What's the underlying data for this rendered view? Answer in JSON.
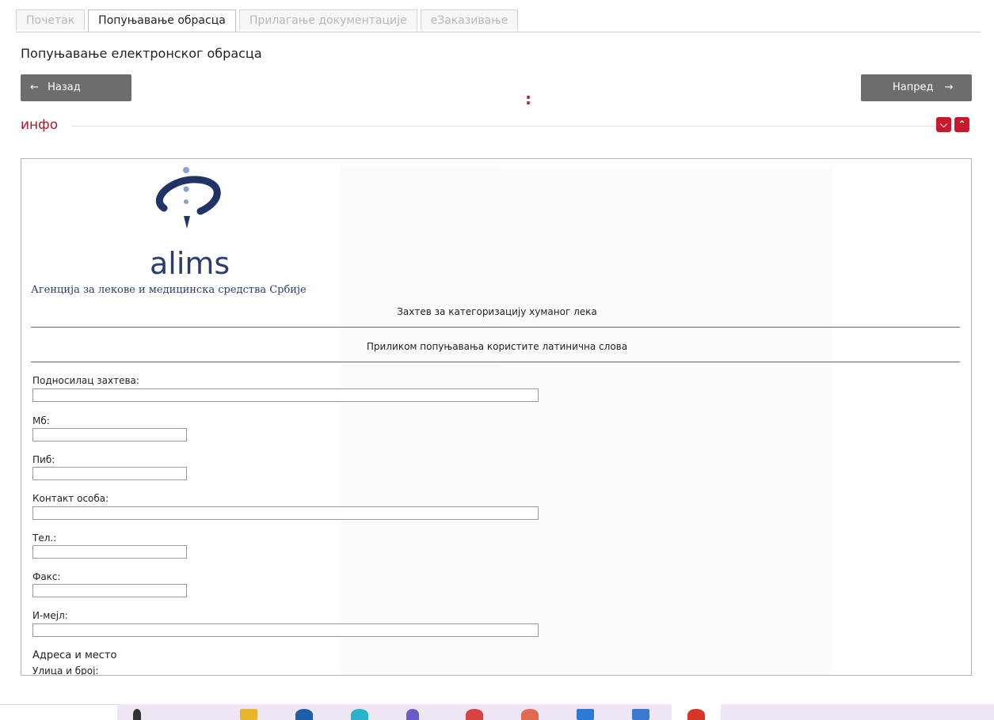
{
  "tabs": [
    {
      "label": "Почетак",
      "active": false
    },
    {
      "label": "Попуњавање обрасца",
      "active": true
    },
    {
      "label": "Прилагање документације",
      "active": false
    },
    {
      "label": "еЗаказивање",
      "active": false
    }
  ],
  "page_heading": "Попуњавање електронског обрасца",
  "nav": {
    "back_label": "Назад",
    "next_label": "Напред",
    "back_icon": "arrow-left-icon",
    "next_icon": "arrow-right-icon"
  },
  "info": {
    "title": "инфо",
    "collapse_icon": "chevron-down-icon",
    "expand_icon": "chevron-up-icon"
  },
  "form": {
    "logo_text": "alims",
    "agency_name": "Агенција за лекове и медицинска средства Србије",
    "title": "Захтев за категоризацију хуманог лека",
    "note": "Приликом попуњавања користите латинична слова",
    "fields": {
      "applicant": {
        "label": "Подносилац захтева:",
        "value": ""
      },
      "mb": {
        "label": "Мб:",
        "value": ""
      },
      "pib": {
        "label": "Пиб:",
        "value": ""
      },
      "contact": {
        "label": "Контакт особа:",
        "value": ""
      },
      "phone": {
        "label": "Тел.:",
        "value": ""
      },
      "fax": {
        "label": "Факс:",
        "value": ""
      },
      "email": {
        "label": "И-мејл:",
        "value": ""
      }
    },
    "address_section": "Адреса и место",
    "street_label": "Улица и број:"
  },
  "colors": {
    "accent_red": "#c9172d",
    "nav_button": "#6d6d6d",
    "brand_blue": "#2a3d6d"
  }
}
